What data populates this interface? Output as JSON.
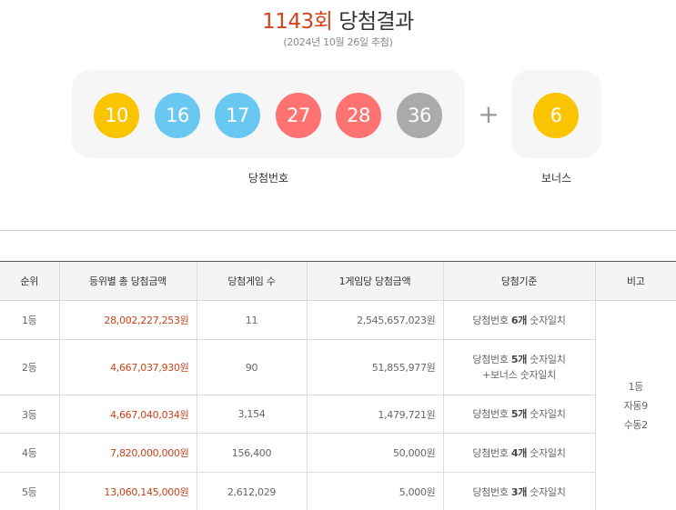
{
  "header": {
    "round": "1143회",
    "title": "당첨결과",
    "date": "(2024년 10월 26일 추첨)"
  },
  "winning_numbers": [
    {
      "number": "10",
      "color": "#fbc400"
    },
    {
      "number": "16",
      "color": "#69c8f2"
    },
    {
      "number": "17",
      "color": "#69c8f2"
    },
    {
      "number": "27",
      "color": "#ff7272"
    },
    {
      "number": "28",
      "color": "#ff7272"
    },
    {
      "number": "36",
      "color": "#aaaaaa"
    }
  ],
  "plus_sign": "+",
  "bonus": {
    "number": "6",
    "color": "#fbc400"
  },
  "captions": {
    "main": "당첨번호",
    "bonus": "보너스"
  },
  "table": {
    "headers": [
      "순위",
      "등위별 총 당첨금액",
      "당첨게임 수",
      "1게임당 당첨금액",
      "당첨기준",
      "비고"
    ],
    "rows": [
      {
        "rank": "1등",
        "total": "28,002,227,253원",
        "count": "11",
        "per_game": "2,545,657,023원",
        "criteria_pre": "당첨번호 ",
        "criteria_bold": "6개",
        "criteria_post": " 숫자일치",
        "criteria_line2": ""
      },
      {
        "rank": "2등",
        "total": "4,667,037,930원",
        "count": "90",
        "per_game": "51,855,977원",
        "criteria_pre": "당첨번호 ",
        "criteria_bold": "5개",
        "criteria_post": " 숫자일치",
        "criteria_line2": "+보너스 숫자일치"
      },
      {
        "rank": "3등",
        "total": "4,667,040,034원",
        "count": "3,154",
        "per_game": "1,479,721원",
        "criteria_pre": "당첨번호 ",
        "criteria_bold": "5개",
        "criteria_post": " 숫자일치",
        "criteria_line2": ""
      },
      {
        "rank": "4등",
        "total": "7,820,000,000원",
        "count": "156,400",
        "per_game": "50,000원",
        "criteria_pre": "당첨번호 ",
        "criteria_bold": "4개",
        "criteria_post": " 숫자일치",
        "criteria_line2": ""
      },
      {
        "rank": "5등",
        "total": "13,060,145,000원",
        "count": "2,612,029",
        "per_game": "5,000원",
        "criteria_pre": "당첨번호 ",
        "criteria_bold": "3개",
        "criteria_post": " 숫자일치",
        "criteria_line2": ""
      }
    ],
    "note": [
      "1등",
      "자동9",
      "수동2"
    ]
  }
}
